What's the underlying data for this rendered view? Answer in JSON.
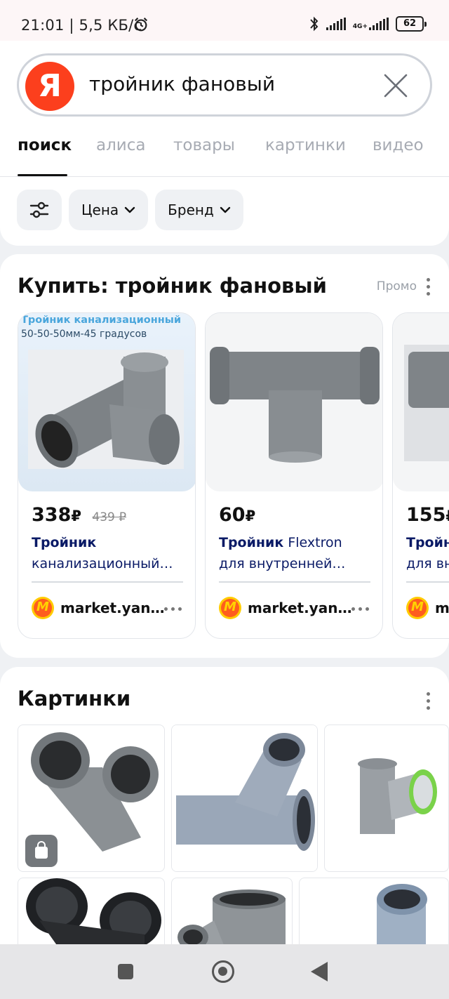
{
  "status_bar": {
    "time_speed": "21:01 | 5,5 КБ/с",
    "network": "4G+",
    "battery": "62"
  },
  "search": {
    "logo": "Я",
    "query": "тройник фановый"
  },
  "tabs": [
    {
      "label": "поиск",
      "active": true
    },
    {
      "label": "алиса",
      "active": false
    },
    {
      "label": "товары",
      "active": false
    },
    {
      "label": "картинки",
      "active": false
    },
    {
      "label": "видео",
      "active": false
    }
  ],
  "filters": {
    "settings_icon": "sliders-icon",
    "chips": [
      "Цена",
      "Бренд"
    ]
  },
  "buy_section": {
    "title": "Купить: тройник фановый",
    "promo_label": "Промо",
    "products": [
      {
        "image_caption_1": "Тройник канализационный",
        "image_caption_2": "50-50-50мм-45 градусов",
        "price": "338",
        "currency": "₽",
        "old_price": "439 ₽",
        "title_bold": "Тройник",
        "title_rest": "канализационный…",
        "shop": "market.yan…"
      },
      {
        "price": "60",
        "currency": "₽",
        "old_price": "",
        "title_bold": "Тройник",
        "title_rest_inline": "Flextron",
        "title_rest": "для внутренней…",
        "shop": "market.yan…"
      },
      {
        "price": "155",
        "currency": "₽",
        "title_bold": "Тройн",
        "title_rest": "для вн",
        "shop": "m"
      }
    ]
  },
  "images_section": {
    "title": "Картинки",
    "badge_icon": "shopping-bag-icon"
  },
  "nav_bar": {
    "icons": [
      "recents-square-icon",
      "home-circle-icon",
      "back-triangle-icon"
    ]
  }
}
